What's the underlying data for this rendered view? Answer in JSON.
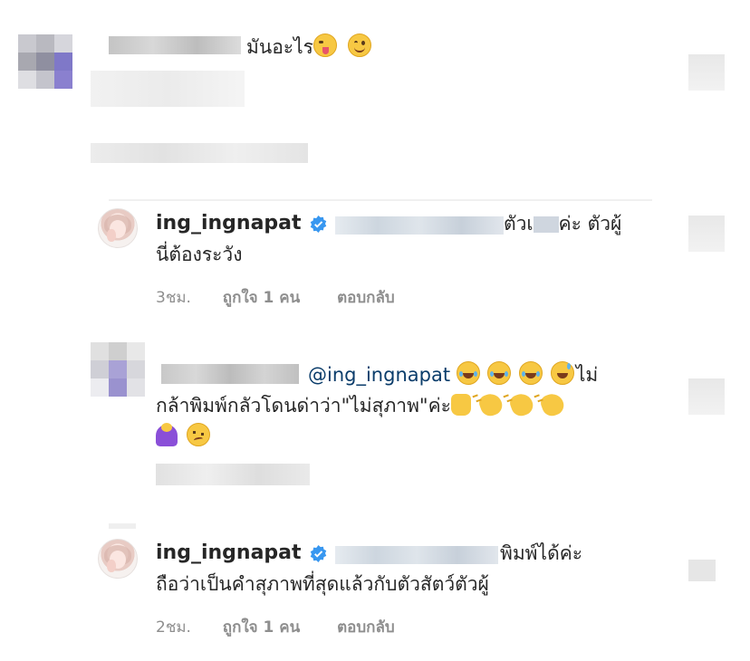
{
  "comments": [
    {
      "text": "มันอะไร",
      "emojis": [
        "winking-face-tongue",
        "smiling-face"
      ]
    },
    {
      "username": "ing_ingnapat",
      "verified": true,
      "line1_text": "ตัวเ",
      "line1_text_b": "ค่ะ ตัวผู้",
      "line2_text": "นี่ต้องระวัง",
      "time": "3ชม.",
      "likes": "ถูกใจ 1 คน",
      "reply_label": "ตอบกลับ"
    },
    {
      "mention": "@ing_ingnapat",
      "line1_suffix": "ไม่",
      "line2_text": "กล้าพิมพ์กลัวโดนด่าว่า\"ไม่สุภาพ\"ค่ะ",
      "line1_emojis": [
        "rolling-laughing",
        "tears-of-joy",
        "rolling-laughing",
        "sweat-smile"
      ],
      "line2_emojis": [
        "thumbs-up",
        "clapping-hands",
        "clapping-hands",
        "clapping-hands"
      ],
      "line3_emojis": [
        "person-bowing",
        "woozy-face"
      ]
    },
    {
      "username": "ing_ingnapat",
      "verified": true,
      "line1_text": "พิมพ์ได้ค่ะ",
      "line2_text": "ถือว่าเป็นคำสุภาพที่สุดแล้วกับตัวสัตว์ตัวผู้",
      "time": "2ชม.",
      "likes": "ถูกใจ 1 คน",
      "reply_label": "ตอบกลับ"
    }
  ],
  "colors": {
    "text": "#262626",
    "meta": "#8e8e8e",
    "mention": "#0b3d6b",
    "verified": "#3897f0"
  }
}
